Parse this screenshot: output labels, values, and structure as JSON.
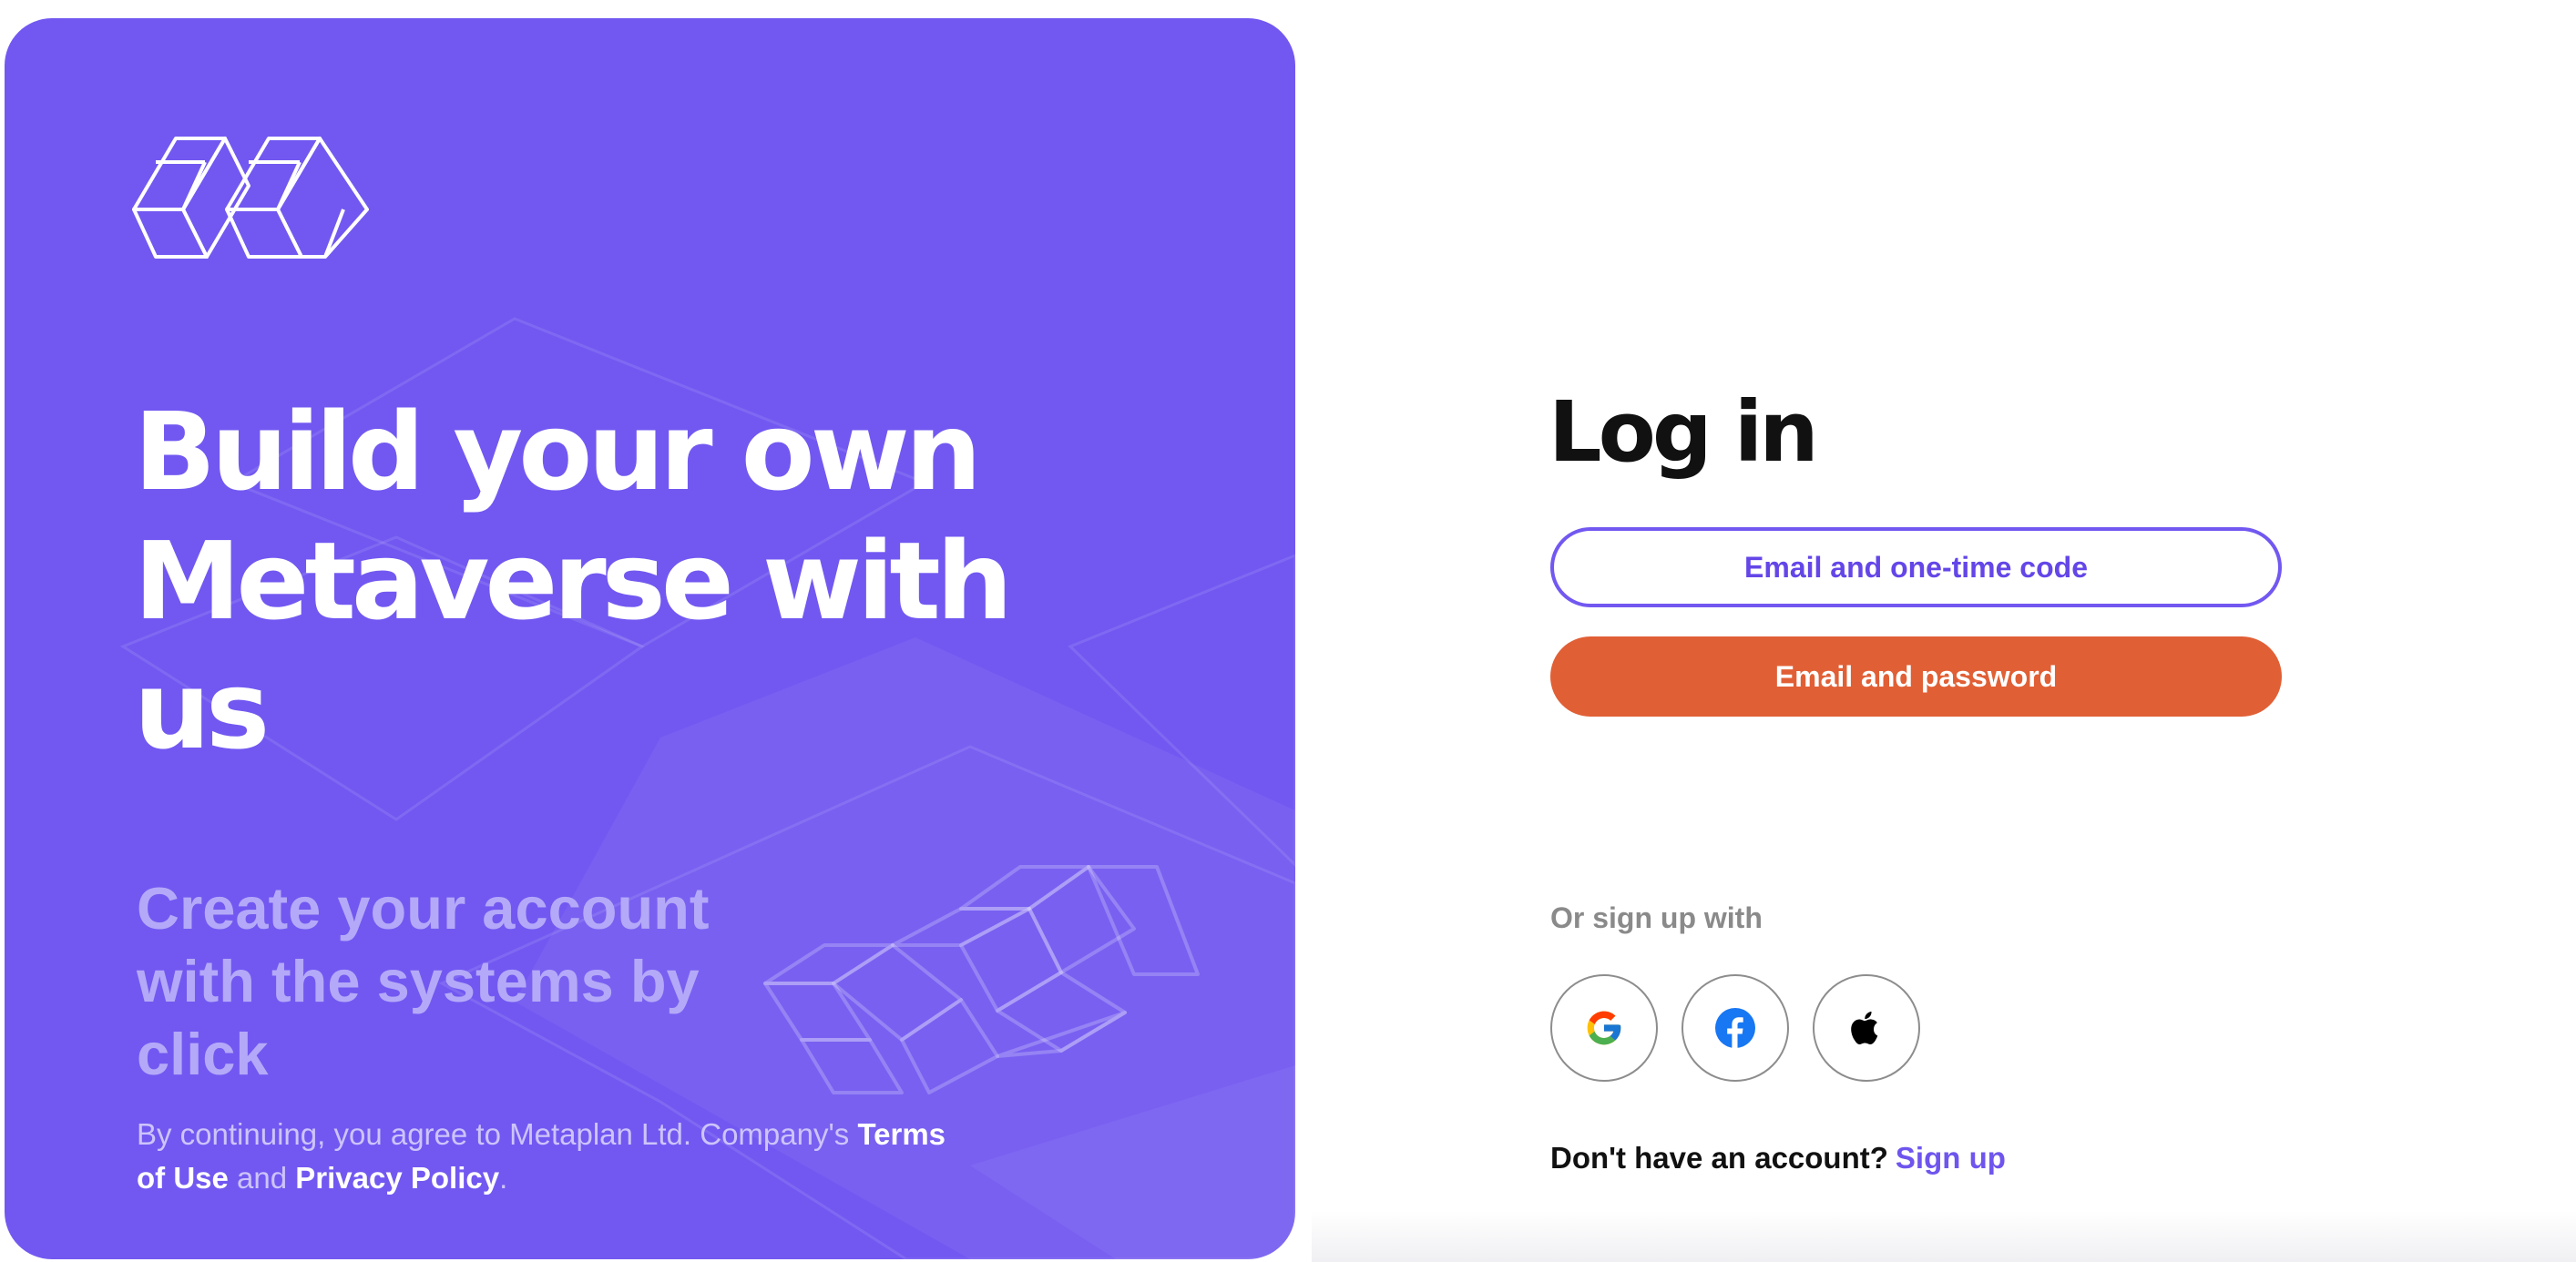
{
  "brand": {
    "accent": "#7258f1",
    "cta": "#e15f35",
    "logo_icon": "cubes-logo-icon"
  },
  "promo": {
    "headline": "Build your own Metaverse with us",
    "subline": "Create your account with the systems by click",
    "legal_prefix": "By continuing, you agree to Metaplan Ltd. Company's ",
    "terms_label": "Terms of Use",
    "legal_and": " and ",
    "privacy_label": "Privacy Policy",
    "legal_suffix": "."
  },
  "login": {
    "title": "Log in",
    "otp_button": "Email and one-time code",
    "password_button": "Email and password",
    "or_sign_up": "Or sign up with",
    "social": [
      {
        "name": "Google",
        "icon": "google-icon"
      },
      {
        "name": "Facebook",
        "icon": "facebook-icon"
      },
      {
        "name": "Apple",
        "icon": "apple-icon"
      }
    ],
    "no_account": "Don't have an account?",
    "sign_up_link": "Sign up"
  }
}
